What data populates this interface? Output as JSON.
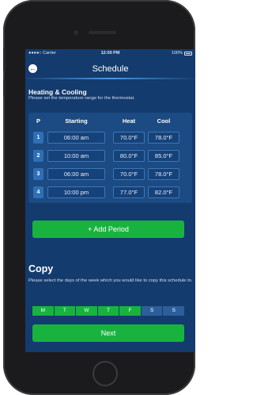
{
  "status_bar": {
    "carrier": "●●●●○ Carrier",
    "time": "12:00 PM",
    "battery": "100%"
  },
  "nav": {
    "title": "Schedule",
    "back_icon": "back-arrow-icon"
  },
  "section": {
    "title": "Heating & Cooling",
    "subtitle": "Please set the temperature range for the thermostat."
  },
  "table": {
    "headers": {
      "p": "P",
      "starting": "Starting",
      "heat": "Heat",
      "cool": "Cool"
    },
    "rows": [
      {
        "p": "1",
        "starting": "06:00  am",
        "heat": "70.0°F",
        "cool": "78.0°F"
      },
      {
        "p": "2",
        "starting": "10:00  am",
        "heat": "80.0°F",
        "cool": "85.0°F"
      },
      {
        "p": "3",
        "starting": "06:00  am",
        "heat": "70.0°F",
        "cool": "78.0°F"
      },
      {
        "p": "4",
        "starting": "10:00  pm",
        "heat": "77.0°F",
        "cool": "82.0°F"
      }
    ]
  },
  "add_period_label": "+ Add Period",
  "copy": {
    "title": "Copy",
    "subtitle": "Please select the days of the week which you would like to copy this schedule to.",
    "days": [
      {
        "label": "M",
        "selected": true
      },
      {
        "label": "T",
        "selected": true
      },
      {
        "label": "W",
        "selected": true
      },
      {
        "label": "T",
        "selected": true
      },
      {
        "label": "F",
        "selected": true
      },
      {
        "label": "S",
        "selected": false
      },
      {
        "label": "S",
        "selected": false
      }
    ]
  },
  "next_label": "Next",
  "colors": {
    "background": "#143b6e",
    "accent_green": "#18b33f",
    "panel": "#1c4a82"
  }
}
